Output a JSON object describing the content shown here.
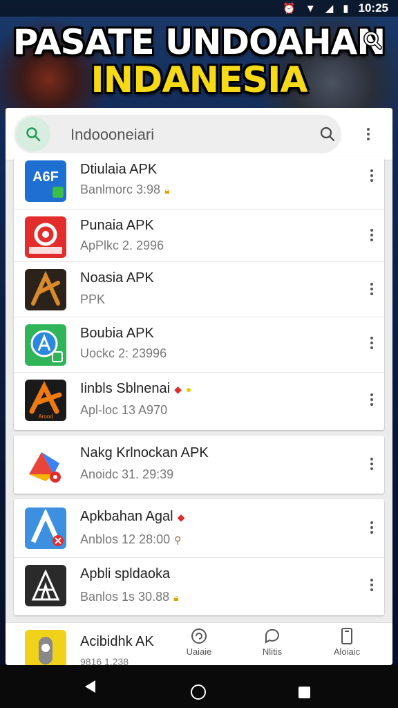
{
  "status_bar": {
    "time": "10:25"
  },
  "header": {
    "title_line1": "PASATE UNDOAHAN",
    "title_line2": "INDANESIA"
  },
  "search": {
    "value": "Indoooneiari"
  },
  "apps": [
    {
      "name": "Dtiulaia APK",
      "meta": "Banlmorc  3:98",
      "icon_text": "A6F",
      "icon_color": "#1e6fd1"
    },
    {
      "name": "Punaia APK",
      "meta": "ApPlkc  2. 2996",
      "icon_text": "",
      "icon_color": "#e32d2d"
    },
    {
      "name": "Noasia APK",
      "meta": "PPK",
      "icon_text": "",
      "icon_color": "#2b2219"
    },
    {
      "name": "Boubia APK",
      "meta": "Uockc  2: 23996",
      "icon_text": "",
      "icon_color": "#2fb45a"
    },
    {
      "name": "Iinbls Sblnenai",
      "meta": "Apl-loc  13  A970",
      "icon_text": "Arood",
      "icon_color": "#1a1a1a"
    },
    {
      "name": "Nakg Krlnockan APK",
      "meta": "Anoidc 31. 29:39",
      "icon_text": "",
      "icon_color": "#ffffff"
    },
    {
      "name": "Apkbahan Agal",
      "meta": "Anblos 12  28:00",
      "icon_text": "",
      "icon_color": "#3d8fe0"
    },
    {
      "name": "Apbli spldaoka",
      "meta": "Banlos 1s  30.88",
      "icon_text": "",
      "icon_color": "#2a2a2a"
    },
    {
      "name": "Acibidhk AK",
      "meta": "9816  1.238",
      "icon_text": "",
      "icon_color": "#f1d21a"
    }
  ],
  "bottom_nav": [
    {
      "label": "Uaiaie",
      "icon": "refresh-icon"
    },
    {
      "label": "Nlitis",
      "icon": "chat-icon"
    },
    {
      "label": "Aloiaic",
      "icon": "phone-icon"
    }
  ],
  "colors": {
    "accent_green": "#1f9d55",
    "title_yellow": "#f6d917",
    "panel_bg": "#ececec"
  }
}
